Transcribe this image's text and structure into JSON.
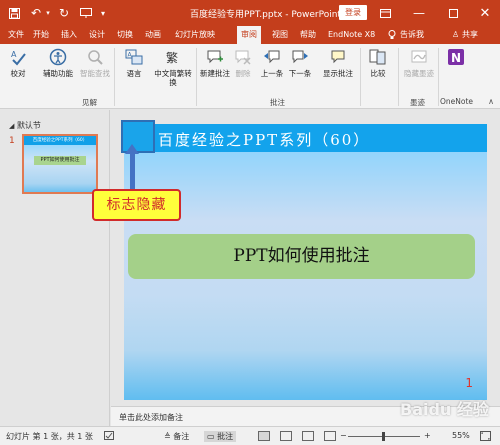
{
  "titlebar": {
    "title": "百度经验专用PPT.pptx  -  PowerPoint",
    "login": "登录",
    "save_icon": "save-icon",
    "undo_icon": "undo-icon",
    "redo_icon": "redo-icon",
    "min_icon": "minimize-icon",
    "max_icon": "maximize-icon",
    "close_icon": "close-icon"
  },
  "tabs": {
    "file": "文件",
    "home": "开始",
    "insert": "插入",
    "design": "设计",
    "transitions": "切换",
    "animations": "动画",
    "slideshow": "幻灯片放映",
    "review": "审阅",
    "view": "视图",
    "help": "帮助",
    "endnote": "EndNote X8",
    "tellme": "告诉我",
    "share": "共享"
  },
  "ribbon": {
    "proofing": "校对",
    "accessibility": "辅助功能",
    "smart_lookup": "智能查找",
    "insights_group": "见解",
    "language": "语言",
    "chinese_convert": "中文简繁转换",
    "new_comment": "新建批注",
    "delete": "删除",
    "previous": "上一条",
    "next": "下一条",
    "show_comments": "显示批注",
    "comments_group": "批注",
    "compare": "比较",
    "hide_ink": "隐藏墨迹",
    "ink_group": "墨迹",
    "onenote_group": "OneNote"
  },
  "leftpane": {
    "section": "默认节",
    "slide_number": "1",
    "thumb_title": "百度经验之PPT系列（60）",
    "thumb_content": "PPT如何使用批注"
  },
  "slide": {
    "title": "百度经验之PPT系列（60）",
    "content": "PPT如何使用批注",
    "page": "1"
  },
  "callout": {
    "text": "标志隐藏"
  },
  "notes": {
    "placeholder": "单击此处添加备注"
  },
  "statusbar": {
    "slide_info": "幻灯片 第 1 张，共 1 张",
    "notes_btn": "备注",
    "comments_btn": "批注",
    "zoom": "55%"
  },
  "watermark": {
    "text": "Baidu 经验"
  },
  "colors": {
    "accent": "#c43e1c",
    "slide_title_bar": "#13a3ec",
    "content_box": "#a4d089",
    "callout_fill": "#ffff3b",
    "callout_border": "#d12b2b"
  }
}
